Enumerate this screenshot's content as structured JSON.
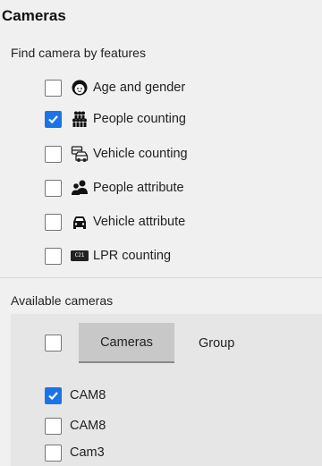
{
  "title": "Cameras",
  "features": {
    "heading": "Find camera by features",
    "items": [
      {
        "label": "Age and gender",
        "checked": false,
        "icon": "face-icon"
      },
      {
        "label": "People counting",
        "checked": true,
        "icon": "people-group-icon"
      },
      {
        "label": "Vehicle counting",
        "checked": false,
        "icon": "vehicle-counting-icon"
      },
      {
        "label": "People attribute",
        "checked": false,
        "icon": "people-attribute-icon"
      },
      {
        "label": "Vehicle attribute",
        "checked": false,
        "icon": "car-icon"
      },
      {
        "label": "LPR counting",
        "checked": false,
        "icon": "license-plate-icon",
        "plate_text": "C21"
      }
    ]
  },
  "cameras": {
    "heading": "Available cameras",
    "tabs": [
      {
        "label": "Cameras",
        "active": true
      },
      {
        "label": "Group",
        "active": false
      }
    ],
    "select_all_checked": false,
    "list": [
      {
        "label": "CAM8",
        "checked": true
      },
      {
        "label": "CAM8",
        "checked": false
      },
      {
        "label": "Cam3",
        "checked": false
      }
    ]
  },
  "colors": {
    "accent": "#1a73e8",
    "background": "#f0f0f0",
    "panel": "#e6e6e6",
    "active_tab": "#c8c8c8"
  }
}
